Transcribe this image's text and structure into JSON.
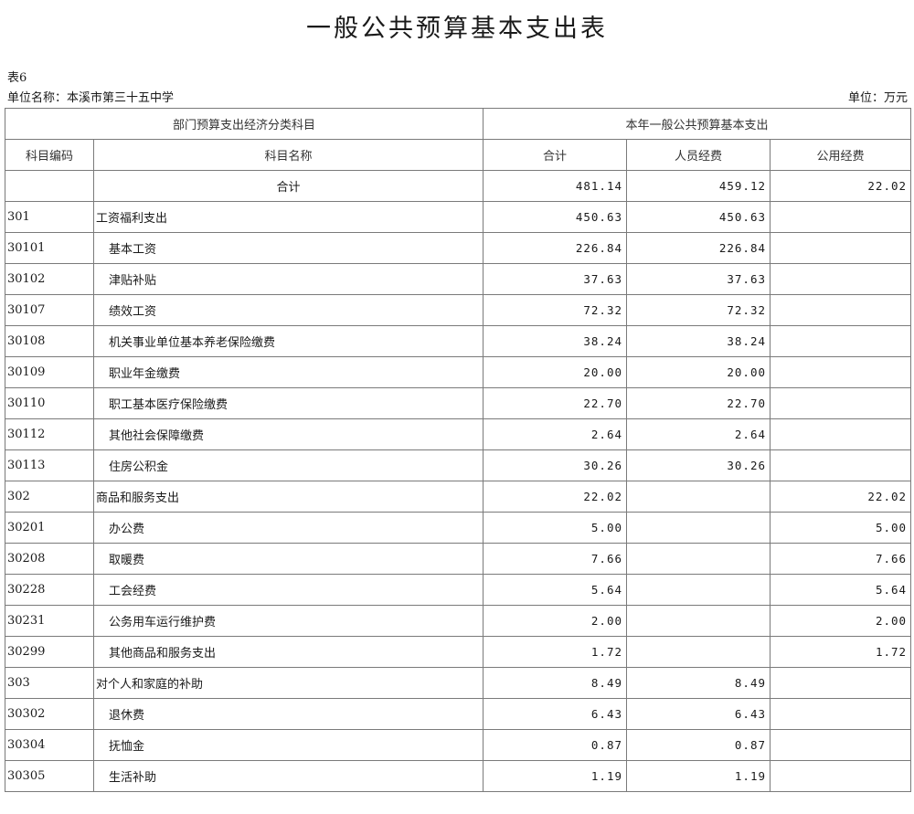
{
  "title": "一般公共预算基本支出表",
  "table_no": "表6",
  "unit_name": "单位名称：本溪市第三十五中学",
  "unit_label": "单位：万元",
  "header": {
    "group_left": "部门预算支出经济分类科目",
    "group_right": "本年一般公共预算基本支出",
    "col_code": "科目编码",
    "col_name": "科目名称",
    "col_total": "合计",
    "col_personnel": "人员经费",
    "col_public": "公用经费"
  },
  "total_row": {
    "label": "合计",
    "total": "481.14",
    "personnel": "459.12",
    "public": "22.02"
  },
  "rows": [
    {
      "code": "301",
      "name": "工资福利支出",
      "total": "450.63",
      "personnel": "450.63",
      "public": ""
    },
    {
      "code": "30101",
      "name": "基本工资",
      "total": "226.84",
      "personnel": "226.84",
      "public": ""
    },
    {
      "code": "30102",
      "name": "津贴补贴",
      "total": "37.63",
      "personnel": "37.63",
      "public": ""
    },
    {
      "code": "30107",
      "name": "绩效工资",
      "total": "72.32",
      "personnel": "72.32",
      "public": ""
    },
    {
      "code": "30108",
      "name": "机关事业单位基本养老保险缴费",
      "total": "38.24",
      "personnel": "38.24",
      "public": ""
    },
    {
      "code": "30109",
      "name": "职业年金缴费",
      "total": "20.00",
      "personnel": "20.00",
      "public": ""
    },
    {
      "code": "30110",
      "name": "职工基本医疗保险缴费",
      "total": "22.70",
      "personnel": "22.70",
      "public": ""
    },
    {
      "code": "30112",
      "name": "其他社会保障缴费",
      "total": "2.64",
      "personnel": "2.64",
      "public": ""
    },
    {
      "code": "30113",
      "name": "住房公积金",
      "total": "30.26",
      "personnel": "30.26",
      "public": ""
    },
    {
      "code": "302",
      "name": "商品和服务支出",
      "total": "22.02",
      "personnel": "",
      "public": "22.02"
    },
    {
      "code": "30201",
      "name": "办公费",
      "total": "5.00",
      "personnel": "",
      "public": "5.00"
    },
    {
      "code": "30208",
      "name": "取暖费",
      "total": "7.66",
      "personnel": "",
      "public": "7.66"
    },
    {
      "code": "30228",
      "name": "工会经费",
      "total": "5.64",
      "personnel": "",
      "public": "5.64"
    },
    {
      "code": "30231",
      "name": "公务用车运行维护费",
      "total": "2.00",
      "personnel": "",
      "public": "2.00"
    },
    {
      "code": "30299",
      "name": "其他商品和服务支出",
      "total": "1.72",
      "personnel": "",
      "public": "1.72"
    },
    {
      "code": "303",
      "name": "对个人和家庭的补助",
      "total": "8.49",
      "personnel": "8.49",
      "public": ""
    },
    {
      "code": "30302",
      "name": "退休费",
      "total": "6.43",
      "personnel": "6.43",
      "public": ""
    },
    {
      "code": "30304",
      "name": "抚恤金",
      "total": "0.87",
      "personnel": "0.87",
      "public": ""
    },
    {
      "code": "30305",
      "name": "生活补助",
      "total": "1.19",
      "personnel": "1.19",
      "public": ""
    }
  ]
}
